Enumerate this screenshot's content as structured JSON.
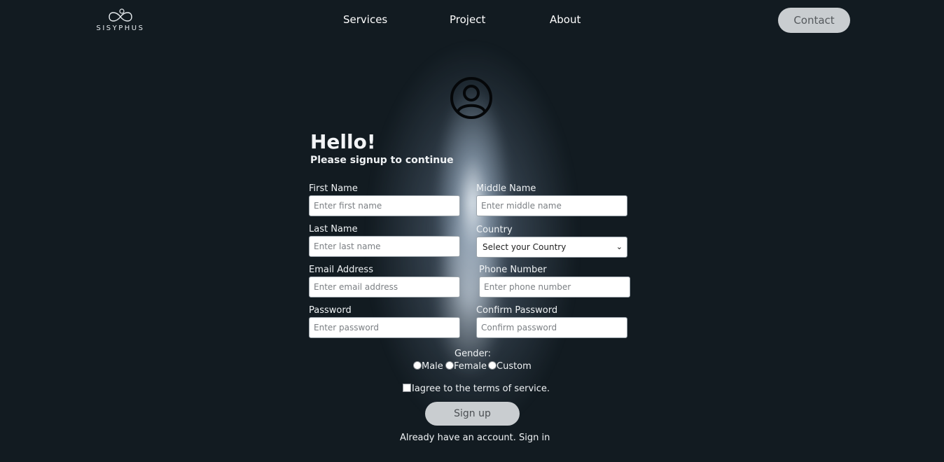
{
  "brand": {
    "name": "SISYPHUS",
    "logo_icon": "infinity-knot-icon"
  },
  "nav": {
    "services": "Services",
    "project": "Project",
    "about": "About",
    "contact": "Contact"
  },
  "form": {
    "avatar_icon": "user-circle-icon",
    "title": "Hello!",
    "subtitle": "Please signup to continue",
    "first_name": {
      "label": "First Name",
      "placeholder": "Enter first name"
    },
    "middle_name": {
      "label": "Middle Name",
      "placeholder": "Enter middle name"
    },
    "last_name": {
      "label": "Last Name",
      "placeholder": "Enter last name"
    },
    "country": {
      "label": "Country",
      "selected": "Select your Country"
    },
    "email": {
      "label": "Email Address",
      "placeholder": "Enter email address"
    },
    "phone": {
      "label": "Phone Number",
      "placeholder": "Enter phone number"
    },
    "password": {
      "label": "Password",
      "placeholder": "Enter password"
    },
    "confirm_password": {
      "label": "Confirm Password",
      "placeholder": "Confirm password"
    },
    "gender": {
      "label": "Gender:",
      "options": [
        "Male",
        "Female",
        "Custom"
      ]
    },
    "terms": "Iagree to the terms of service.",
    "submit": "Sign up",
    "already": "Already have an account.",
    "signin": "Sign in"
  }
}
